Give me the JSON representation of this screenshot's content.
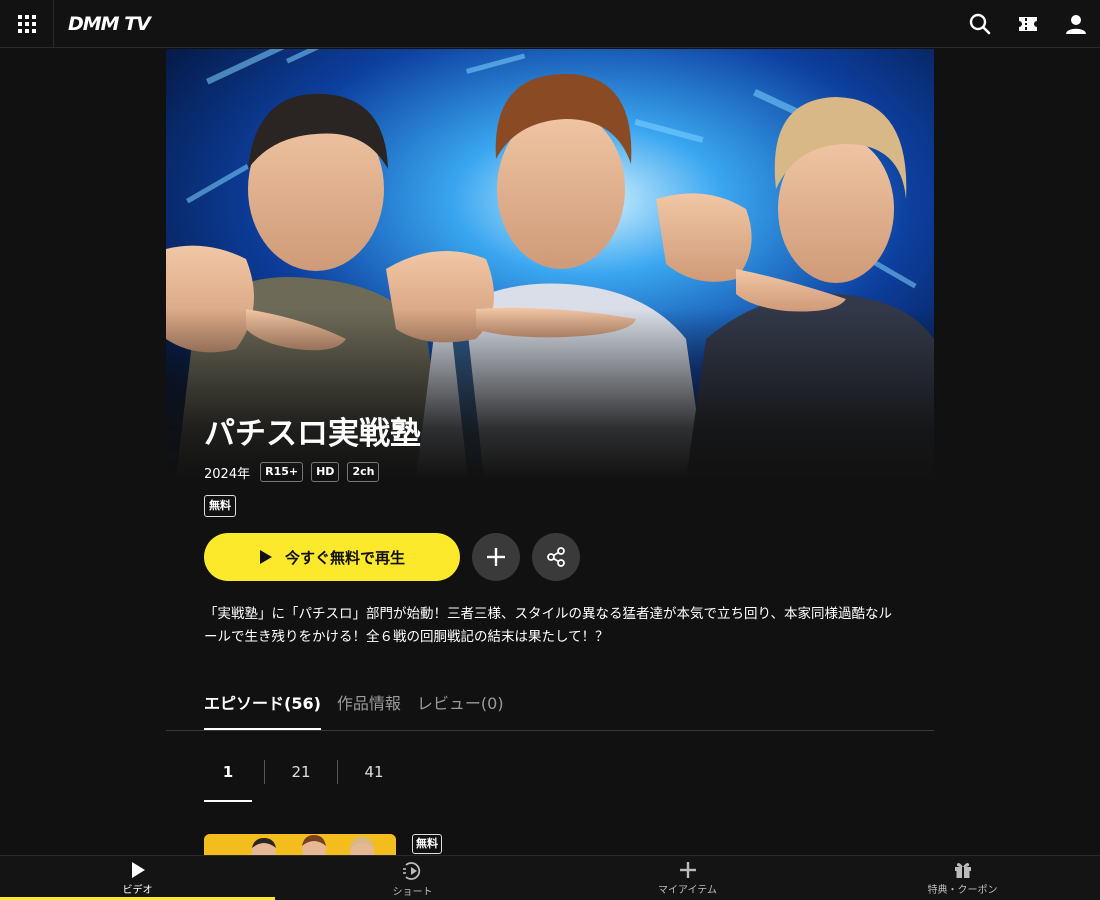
{
  "header": {
    "logo": "DMM TV",
    "icons": [
      "grid-menu-icon",
      "search-icon",
      "ticket-icon",
      "user-icon"
    ]
  },
  "hero": {
    "image": "three-men-pointing-thumbs-cyber-background"
  },
  "title": {
    "text": "パチスロ実戦塾",
    "year": "2024年",
    "tags": [
      "R15+",
      "HD",
      "2ch"
    ],
    "free_badge": "無料"
  },
  "actions": {
    "play_label": "今すぐ無料で再生",
    "add_icon": "plus-icon",
    "share_icon": "share-icon",
    "accent": "#fde92c"
  },
  "description": "「実戦塾」に「パチスロ」部門が始動！三者三様、スタイルの異なる猛者達が本気で立ち回り、本家同様過酷なルールで生き残りをかける！全６戦の回胴戦記の結末は果たして！？",
  "tabs": [
    {
      "label": "エピソード(56)",
      "active": true
    },
    {
      "label": "作品情報",
      "active": false
    },
    {
      "label": "レビュー(0)",
      "active": false
    }
  ],
  "pager": {
    "pages": [
      "1",
      "21",
      "41"
    ],
    "active": "1"
  },
  "episode": {
    "free_badge": "無料"
  },
  "bottom_nav": {
    "items": [
      {
        "label": "ビデオ",
        "icon": "play-icon",
        "active": true
      },
      {
        "label": "ショート",
        "icon": "short-play-icon",
        "active": false
      },
      {
        "label": "マイアイテム",
        "icon": "plus-icon",
        "active": false
      },
      {
        "label": "特典・クーポン",
        "icon": "gift-icon",
        "active": false
      }
    ]
  }
}
